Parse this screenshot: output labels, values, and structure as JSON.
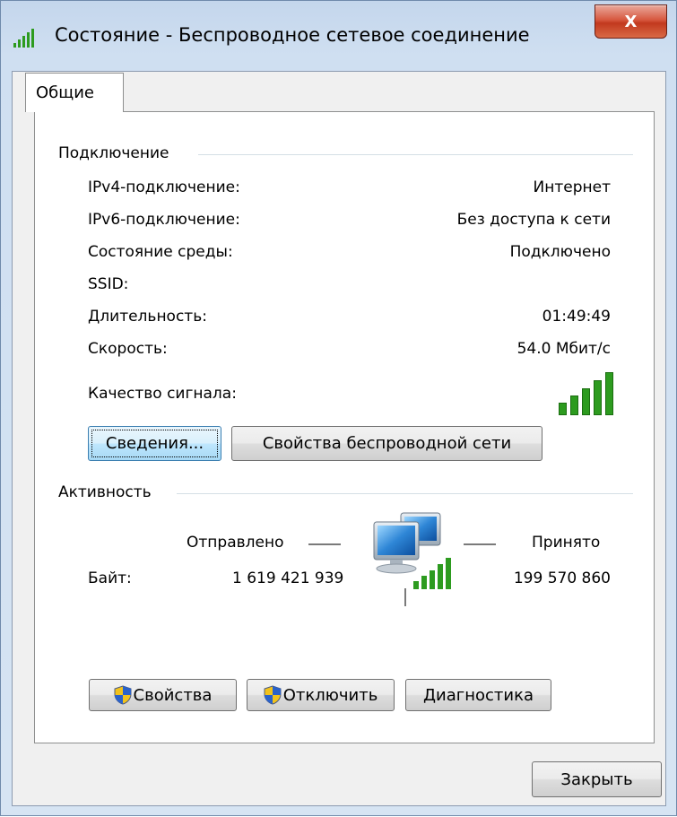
{
  "window": {
    "title": "Состояние - Беспроводное сетевое соединение",
    "close_glyph": "X"
  },
  "tabs": [
    {
      "label": "Общие",
      "active": true
    }
  ],
  "connection": {
    "header": "Подключение",
    "rows": [
      {
        "label": "IPv4-подключение:",
        "value": "Интернет"
      },
      {
        "label": "IPv6-подключение:",
        "value": "Без доступа к сети"
      },
      {
        "label": "Состояние среды:",
        "value": "Подключено"
      },
      {
        "label": "SSID:",
        "value": ""
      },
      {
        "label": "Длительность:",
        "value": "01:49:49"
      },
      {
        "label": "Скорость:",
        "value": "54.0 Мбит/с"
      }
    ],
    "signal_label": "Качество сигнала:",
    "signal_level": "5/5",
    "details_button": "Сведения...",
    "wireless_props_button": "Свойства беспроводной сети"
  },
  "activity": {
    "header": "Активность",
    "sent_label": "Отправлено",
    "received_label": "Принято",
    "bytes_label": "Байт:",
    "bytes_sent": "1 619 421 939",
    "bytes_received": "199 570 860",
    "icon": "network-computers-icon"
  },
  "buttons": {
    "properties": "Свойства",
    "disable": "Отключить",
    "diagnose": "Диагностика",
    "close": "Закрыть"
  },
  "colors": {
    "signal_green": "#2d9b1f",
    "close_red": "#c2391e",
    "default_button_border": "#3c7fb1"
  }
}
